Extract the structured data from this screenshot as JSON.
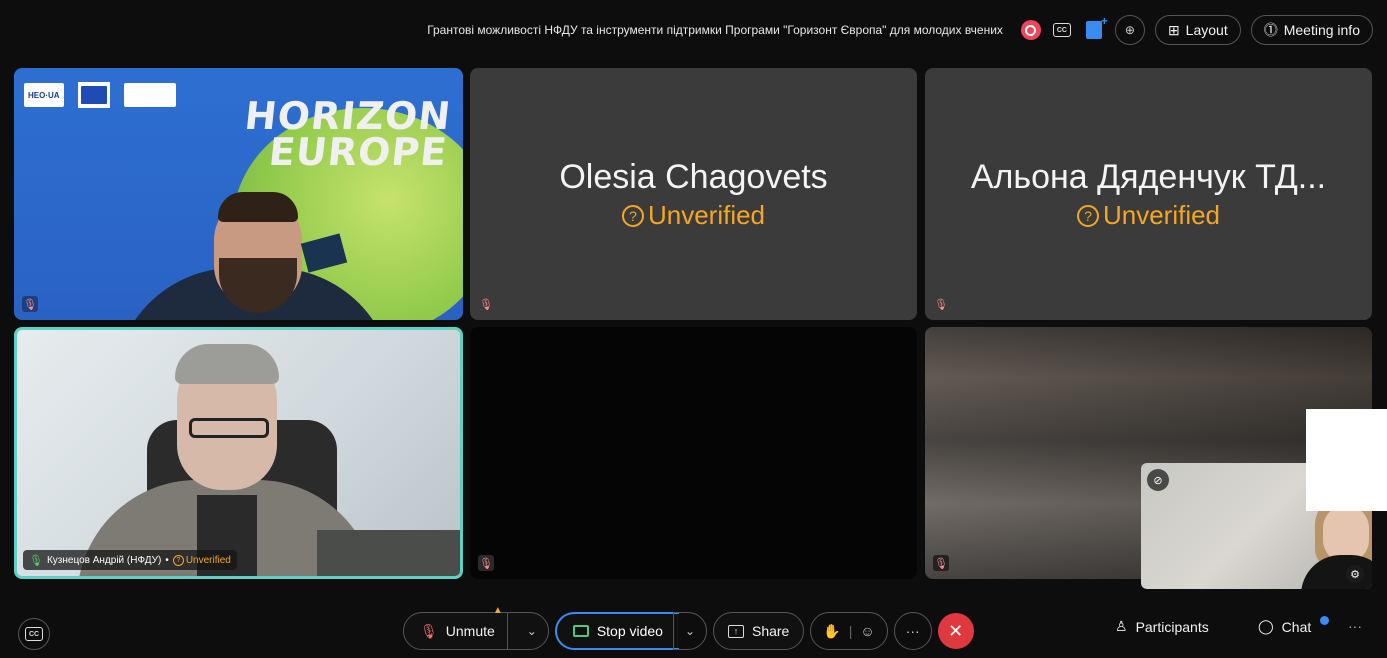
{
  "topbar": {
    "title": "Грантові можливості НФДУ та інструменти підтримки Програми \"Горизонт Європа\" для молодих вчених",
    "cc_label": "CC",
    "layout_label": "Layout",
    "meeting_info_label": "Meeting info",
    "icons": [
      "record-icon",
      "closed-caption-icon",
      "notes-icon",
      "zoom-icon",
      "layout-icon",
      "info-icon"
    ]
  },
  "tiles": {
    "horizon": {
      "logo_label": "HEO·UA",
      "banner_text_1": "HORIZON",
      "banner_text_2": "EUROPE"
    },
    "olesia": {
      "name": "Olesia Chagovets",
      "status": "Unverified"
    },
    "alona": {
      "name": "Альона Дяденчук ТД...",
      "status": "Unverified"
    },
    "speaker": {
      "name": "Кузнецов Андрій (НФДУ)",
      "separator": "•",
      "status": "Unverified"
    }
  },
  "bottombar": {
    "cc_label": "CC",
    "unmute_label": "Unmute",
    "stop_video_label": "Stop video",
    "share_label": "Share",
    "more_label": "···",
    "leave_label": "✕",
    "participants_label": "Participants",
    "chat_label": "Chat",
    "overflow_label": "···"
  },
  "colors": {
    "accent_blue": "#3b8cf2",
    "unverified_orange": "#f5a623",
    "leave_red": "#e0383f",
    "active_speaker_border": "#5fd0c4"
  }
}
